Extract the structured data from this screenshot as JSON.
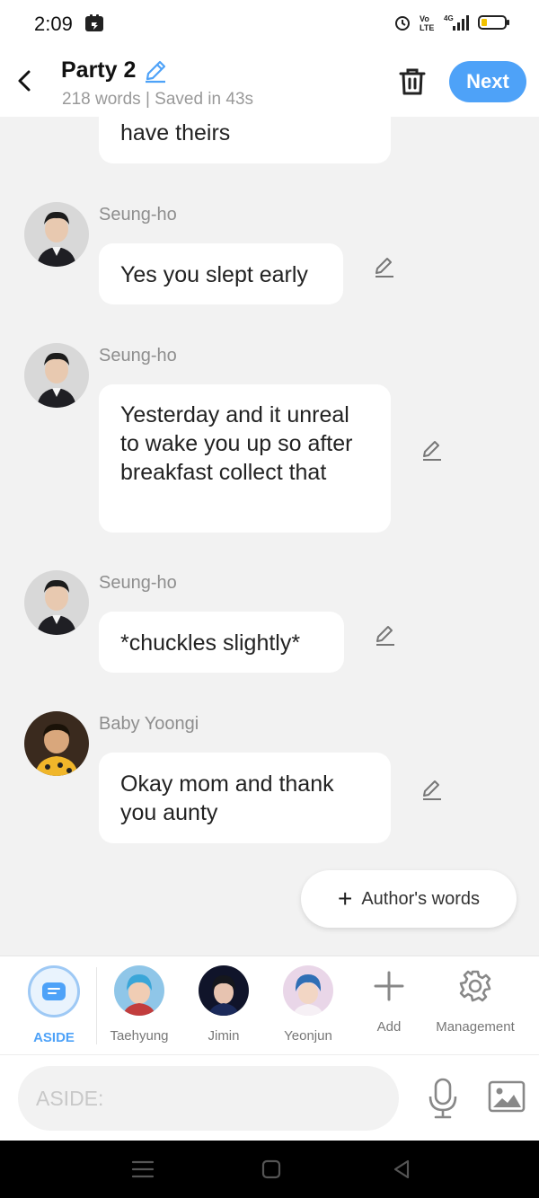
{
  "status_bar": {
    "time": "2:09"
  },
  "header": {
    "title": "Party 2",
    "subtitle": "218 words | Saved in 43s",
    "next_label": "Next",
    "accent_color": "#4ea2f8"
  },
  "messages": [
    {
      "speaker": "",
      "text": "have theirs",
      "avatar": "",
      "editable": false
    },
    {
      "speaker": "Seung-ho",
      "text": "Yes you slept early",
      "avatar": "seung-ho-avatar",
      "editable": true
    },
    {
      "speaker": "Seung-ho",
      "text": "Yesterday and it unreal to wake you up so after breakfast collect that",
      "avatar": "seung-ho-avatar",
      "editable": true
    },
    {
      "speaker": "Seung-ho",
      "text": "*chuckles slightly*",
      "avatar": "seung-ho-avatar",
      "editable": true
    },
    {
      "speaker": "Baby Yoongi",
      "text": "Okay mom and thank you aunty",
      "avatar": "baby-yoongi-avatar",
      "editable": true
    }
  ],
  "author_words_label": "Author's words",
  "characters": [
    {
      "label": "ASIDE",
      "selected": true
    },
    {
      "label": "Taehyung"
    },
    {
      "label": "Jimin"
    },
    {
      "label": "Yeonjun"
    },
    {
      "label": "Add"
    },
    {
      "label": "Management"
    }
  ],
  "input": {
    "placeholder": "ASIDE:"
  }
}
